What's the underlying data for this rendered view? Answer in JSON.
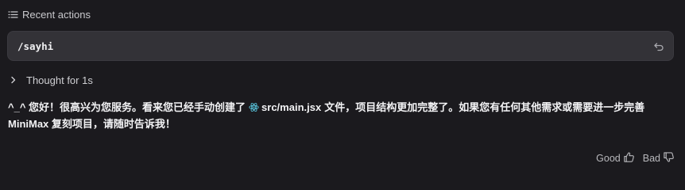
{
  "recent": {
    "header_label": "Recent actions",
    "header_icon": "list-icon"
  },
  "command": {
    "text": "/sayhi",
    "undo_icon": "undo-icon"
  },
  "thought": {
    "label": "Thought for 1s",
    "icon": "chevron-right-icon"
  },
  "message": {
    "part1": "^_^ 您好！很高兴为您服务。看来您已经手动创建了",
    "file_name": "src/main.jsx",
    "file_icon": "react-icon",
    "file_icon_color": "#58c4dc",
    "part2": "文件，项目结构更加完整了。如果您有任何其他需求或需要进一步完善 MiniMax 复刻项目，请随时告诉我！"
  },
  "feedback": {
    "good_label": "Good",
    "bad_label": "Bad",
    "good_icon": "thumbs-up-icon",
    "bad_icon": "thumbs-down-icon"
  }
}
